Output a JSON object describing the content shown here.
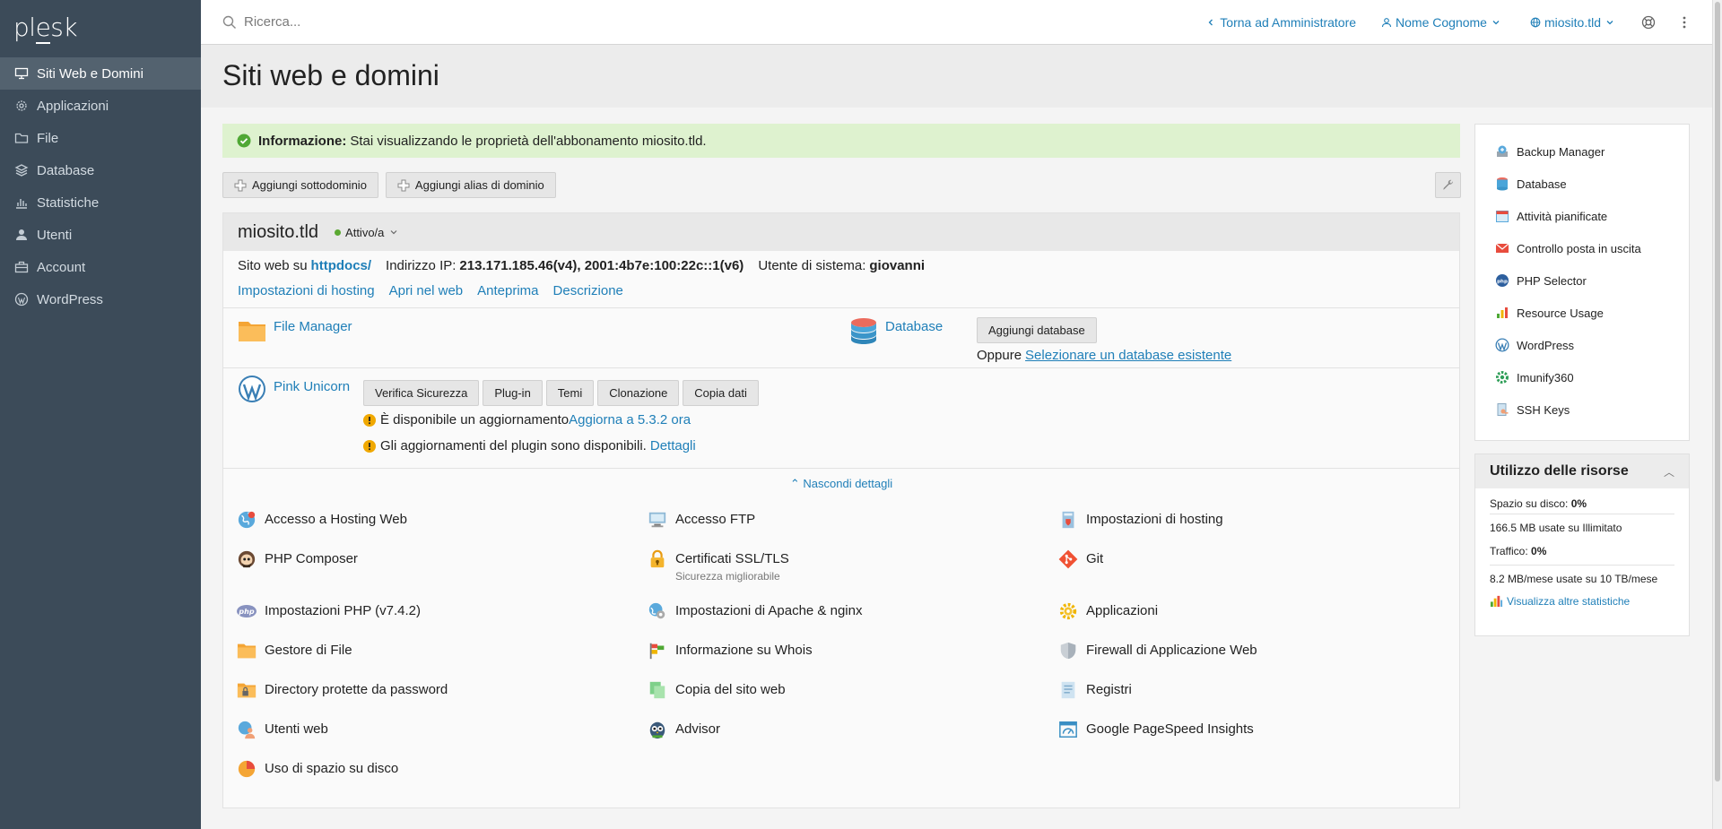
{
  "sidebar": {
    "logo": "plesk",
    "items": [
      {
        "label": "Siti Web e Domini",
        "icon": "monitor-icon",
        "active": true
      },
      {
        "label": "Applicazioni",
        "icon": "gear-icon"
      },
      {
        "label": "File",
        "icon": "folder-icon"
      },
      {
        "label": "Database",
        "icon": "layers-icon"
      },
      {
        "label": "Statistiche",
        "icon": "bar-chart-icon"
      },
      {
        "label": "Utenti",
        "icon": "user-icon"
      },
      {
        "label": "Account",
        "icon": "briefcase-icon"
      },
      {
        "label": "WordPress",
        "icon": "wordpress-icon"
      }
    ]
  },
  "topbar": {
    "search_placeholder": "Ricerca...",
    "back_admin": "Torna ad Amministratore",
    "user_name": "Nome Cognome",
    "domain": "miosito.tld"
  },
  "page": {
    "title": "Siti web e domini"
  },
  "info": {
    "label": "Informazione:",
    "text": "Stai visualizzando le proprietà dell'abbonamento miosito.tld."
  },
  "buttons": {
    "add_subdomain": "Aggiungi sottodominio",
    "add_alias": "Aggiungi alias di dominio"
  },
  "domain": {
    "name": "miosito.tld",
    "status": "Attivo/a",
    "site_label": "Sito web su",
    "site_path": "httpdocs/",
    "ip_label": "Indirizzo IP:",
    "ip_value": "213.171.185.46(v4), 2001:4b7e:100:22c::1(v6)",
    "user_label": "Utente di sistema:",
    "user_value": "giovanni",
    "links": [
      "Impostazioni di hosting",
      "Apri nel web",
      "Anteprima",
      "Descrizione"
    ],
    "file_manager": "File Manager",
    "database": "Database",
    "add_database": "Aggiungi database",
    "or_label": "Oppure",
    "select_db": "Selezionare un database esistente",
    "wp_name": "Pink Unicorn",
    "wp_buttons": [
      "Verifica Sicurezza",
      "Plug-in",
      "Temi",
      "Clonazione",
      "Copia dati"
    ],
    "update_text": "È disponibile un aggiornamento",
    "update_link": "Aggiorna a 5.3.2 ora",
    "plugin_text": "Gli aggiornamenti del plugin sono disponibili.",
    "plugin_link": "Dettagli",
    "hide_details": "Nascondi dettagli"
  },
  "tools": [
    {
      "label": "Accesso a Hosting Web",
      "icon": "globe-icon"
    },
    {
      "label": "Accesso FTP",
      "icon": "ftp-icon"
    },
    {
      "label": "Impostazioni di hosting",
      "icon": "hosting-settings-icon"
    },
    {
      "label": "PHP Composer",
      "icon": "composer-icon"
    },
    {
      "label": "Certificati SSL/TLS",
      "sub": "Sicurezza migliorabile",
      "icon": "lock-icon"
    },
    {
      "label": "Git",
      "icon": "git-icon"
    },
    {
      "label": "Impostazioni PHP (v7.4.2)",
      "icon": "php-icon"
    },
    {
      "label": "Impostazioni di Apache & nginx",
      "icon": "apache-icon"
    },
    {
      "label": "Applicazioni",
      "icon": "sun-gear-icon"
    },
    {
      "label": "Gestore di File",
      "icon": "folder-icon"
    },
    {
      "label": "Informazione su Whois",
      "icon": "flags-icon"
    },
    {
      "label": "Firewall di Applicazione Web",
      "icon": "shield-icon"
    },
    {
      "label": "Directory protette da password",
      "icon": "protected-folder-icon"
    },
    {
      "label": "Copia del sito web",
      "icon": "copy-icon"
    },
    {
      "label": "Registri",
      "icon": "logs-icon"
    },
    {
      "label": "Utenti web",
      "icon": "web-users-icon"
    },
    {
      "label": "Advisor",
      "icon": "owl-icon"
    },
    {
      "label": "Google PageSpeed Insights",
      "icon": "speed-icon"
    },
    {
      "label": "Uso di spazio su disco",
      "icon": "pie-icon"
    }
  ],
  "right_tools": [
    {
      "label": "Backup Manager",
      "icon": "backup-icon"
    },
    {
      "label": "Database",
      "icon": "database-icon"
    },
    {
      "label": "Attività pianificate",
      "icon": "calendar-icon"
    },
    {
      "label": "Controllo posta in uscita",
      "icon": "mail-icon"
    },
    {
      "label": "PHP Selector",
      "icon": "php-selector-icon"
    },
    {
      "label": "Resource Usage",
      "icon": "resource-icon"
    },
    {
      "label": "WordPress",
      "icon": "wordpress-icon"
    },
    {
      "label": "Imunify360",
      "icon": "imunify-icon"
    },
    {
      "label": "SSH Keys",
      "icon": "key-icon"
    }
  ],
  "resources": {
    "title": "Utilizzo delle risorse",
    "disk_label": "Spazio su disco:",
    "disk_pct": "0%",
    "disk_detail": "166.5 MB usate su Illimitato",
    "traffic_label": "Traffico:",
    "traffic_pct": "0%",
    "traffic_detail": "8.2 MB/mese usate su 10 TB/mese",
    "more_stats": "Visualizza altre statistiche"
  }
}
